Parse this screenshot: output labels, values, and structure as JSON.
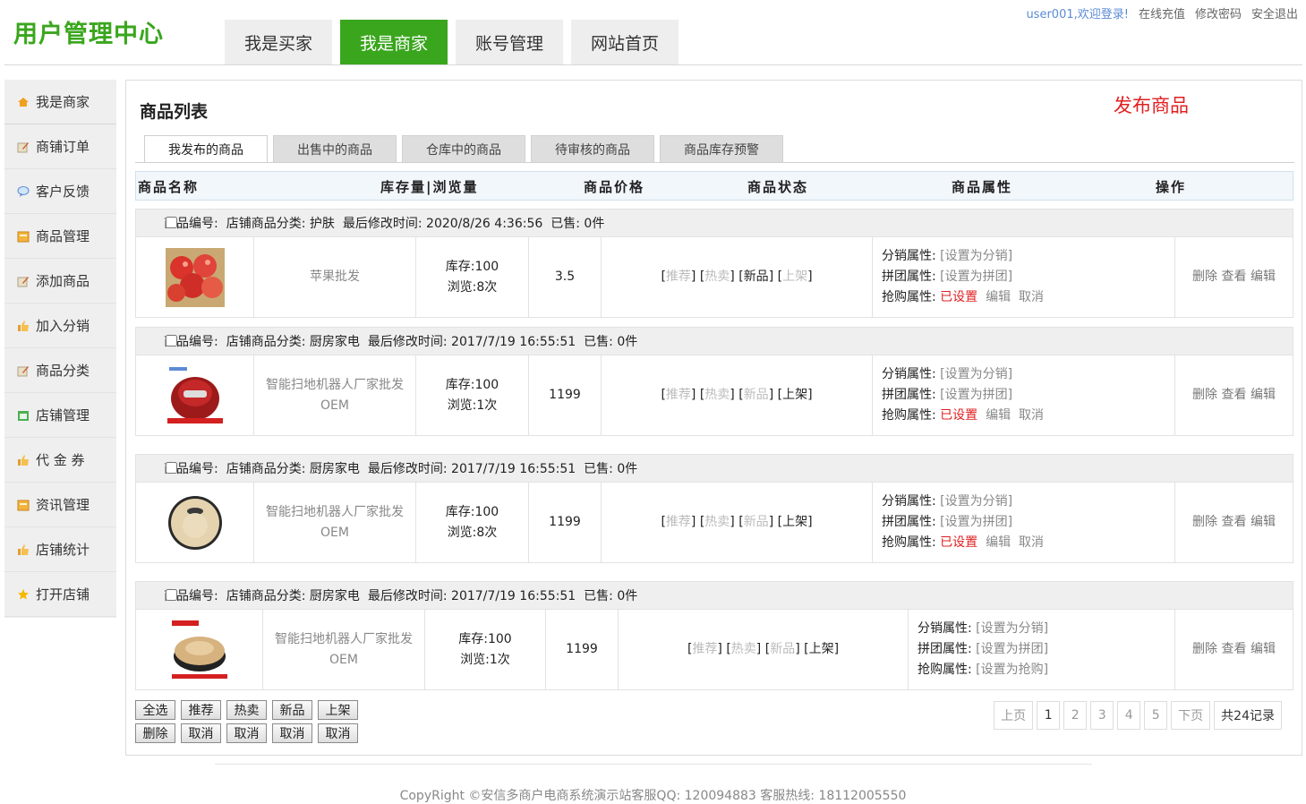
{
  "header": {
    "logo": "用户管理中心",
    "nav": [
      "我是买家",
      "我是商家",
      "账号管理",
      "网站首页"
    ],
    "active_nav": 1,
    "user_greeting": "user001,欢迎登录!",
    "links": [
      "在线充值",
      "修改密码",
      "安全退出"
    ]
  },
  "sidebar": {
    "items": [
      {
        "label": "我是商家",
        "icon": "house-icon"
      },
      {
        "label": "商铺订单",
        "icon": "edit-note-icon"
      },
      {
        "label": "客户反馈",
        "icon": "speech-bubble-icon"
      },
      {
        "label": "商品管理",
        "icon": "box-icon"
      },
      {
        "label": "添加商品",
        "icon": "edit-note-icon"
      },
      {
        "label": "加入分销",
        "icon": "thumbs-up-icon"
      },
      {
        "label": "商品分类",
        "icon": "edit-note-icon"
      },
      {
        "label": "店铺管理",
        "icon": "shop-icon"
      },
      {
        "label": "代 金 券",
        "icon": "thumbs-up-icon"
      },
      {
        "label": "资讯管理",
        "icon": "box-icon"
      },
      {
        "label": "店铺统计",
        "icon": "thumbs-up-icon"
      },
      {
        "label": "打开店铺",
        "icon": "star-icon"
      }
    ]
  },
  "main": {
    "title": "商品列表",
    "publish_label": "发布商品",
    "tabs": [
      "我发布的商品",
      "出售中的商品",
      "仓库中的商品",
      "待审核的商品",
      "商品库存预警"
    ],
    "columns": [
      "商品名称",
      "库存量|浏览量",
      "商品价格",
      "商品状态",
      "商品属性",
      "操作"
    ],
    "products": [
      {
        "meta": {
          "code": "商品编号:",
          "category": "店铺商品分类:  护肤",
          "modified": "最后修改时间:  2020/8/26 4:36:56",
          "sold": "已售:  0件"
        },
        "image": "apples-image",
        "name": [
          "苹果批发"
        ],
        "stock": "库存:100",
        "views": "浏览:8次",
        "price": "3.5",
        "status": [
          {
            "t": "推荐",
            "on": false
          },
          {
            "t": "热卖",
            "on": false
          },
          {
            "t": "新品",
            "on": true
          },
          {
            "t": "上架",
            "on": false
          }
        ],
        "attrs": [
          {
            "label": "分销属性:",
            "value": "[设置为分销]",
            "set": false
          },
          {
            "label": "拼团属性:",
            "value": "[设置为拼团]",
            "set": false
          },
          {
            "label": "抢购属性:",
            "value": "已设置",
            "set": true,
            "extra": [
              "编辑",
              "取消"
            ]
          }
        ],
        "ops": [
          "删除",
          "查看",
          "编辑"
        ]
      },
      {
        "meta": {
          "code": "商品编号:",
          "category": "店铺商品分类:  厨房家电",
          "modified": "最后修改时间:  2017/7/19 16:55:51",
          "sold": "已售:  0件"
        },
        "image": "red-robot-vacuum-image",
        "name": [
          "智能扫地机器人厂家批发",
          "OEM"
        ],
        "stock": "库存:100",
        "views": "浏览:1次",
        "price": "1199",
        "status": [
          {
            "t": "推荐",
            "on": false
          },
          {
            "t": "热卖",
            "on": false
          },
          {
            "t": "新品",
            "on": false
          },
          {
            "t": "上架",
            "on": true
          }
        ],
        "attrs": [
          {
            "label": "分销属性:",
            "value": "[设置为分销]",
            "set": false
          },
          {
            "label": "拼团属性:",
            "value": "[设置为拼团]",
            "set": false
          },
          {
            "label": "抢购属性:",
            "value": "已设置",
            "set": true,
            "extra": [
              "编辑",
              "取消"
            ]
          }
        ],
        "ops": [
          "删除",
          "查看",
          "编辑"
        ]
      },
      {
        "meta": {
          "code": "商品编号:",
          "category": "店铺商品分类:  厨房家电",
          "modified": "最后修改时间:  2017/7/19 16:55:51",
          "sold": "已售:  0件"
        },
        "image": "beige-robot-vacuum-image",
        "name": [
          "智能扫地机器人厂家批发",
          "OEM"
        ],
        "stock": "库存:100",
        "views": "浏览:8次",
        "price": "1199",
        "status": [
          {
            "t": "推荐",
            "on": false
          },
          {
            "t": "热卖",
            "on": false
          },
          {
            "t": "新品",
            "on": false
          },
          {
            "t": "上架",
            "on": true
          }
        ],
        "attrs": [
          {
            "label": "分销属性:",
            "value": "[设置为分销]",
            "set": false
          },
          {
            "label": "拼团属性:",
            "value": "[设置为拼团]",
            "set": false
          },
          {
            "label": "抢购属性:",
            "value": "已设置",
            "set": true,
            "extra": [
              "编辑",
              "取消"
            ]
          }
        ],
        "ops": [
          "删除",
          "查看",
          "编辑"
        ]
      },
      {
        "meta": {
          "code": "商品编号:",
          "category": "店铺商品分类:  厨房家电",
          "modified": "最后修改时间:  2017/7/19 16:55:51",
          "sold": "已售:  0件"
        },
        "image": "gold-robot-vacuum-image",
        "name": [
          "智能扫地机器人厂家批发",
          "OEM"
        ],
        "stock": "库存:100",
        "views": "浏览:1次",
        "price": "1199",
        "status": [
          {
            "t": "推荐",
            "on": false
          },
          {
            "t": "热卖",
            "on": false
          },
          {
            "t": "新品",
            "on": false
          },
          {
            "t": "上架",
            "on": true
          }
        ],
        "attrs": [
          {
            "label": "分销属性:",
            "value": "[设置为分销]",
            "set": false
          },
          {
            "label": "拼团属性:",
            "value": "[设置为拼团]",
            "set": false
          },
          {
            "label": "抢购属性:",
            "value": "[设置为抢购]",
            "set": false
          }
        ],
        "ops": [
          "删除",
          "查看",
          "编辑"
        ]
      }
    ],
    "bulk_buttons": [
      "全选",
      "推荐",
      "热卖",
      "新品",
      "上架",
      "删除",
      "取消",
      "取消",
      "取消",
      "取消"
    ],
    "pager": {
      "prev": "上页",
      "pages": [
        "1",
        "2",
        "3",
        "4",
        "5"
      ],
      "current": "1",
      "next": "下页",
      "total": "共24记录"
    }
  },
  "footer": {
    "text": "CopyRight ©安信多商户电商系统演示站客服QQ:  120094883 客服热线:  18112005550"
  },
  "colors": {
    "brand_green": "#3aa61d",
    "alert_red": "#e02020",
    "link_blue": "#5b8bd6"
  }
}
